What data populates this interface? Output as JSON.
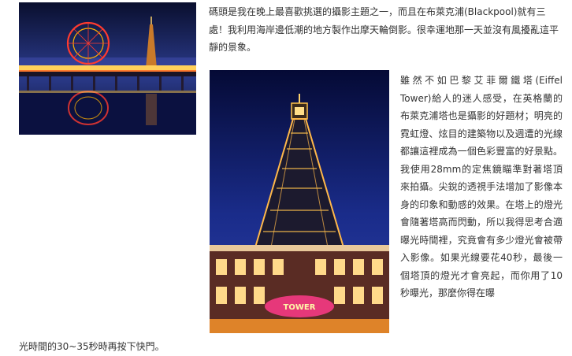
{
  "article": {
    "photo1_alt": "Blackpool pier ferris wheel at night reflected in water",
    "photo2_alt": "Blackpool Tower illuminated at night",
    "paragraph1": "碼頭是我在晚上最喜歡挑選的攝影主題之一，而且在布萊克浦(Blackpool)就有三處！我利用海岸邊低潮的地方製作出摩天輪倒影。很幸運地那一天並沒有風擾亂這平靜的景象。",
    "paragraph2": "雖然不如巴黎艾菲爾鐵塔(Eiffel Tower)給人的迷人感受，在英格蘭的布萊克浦塔也是攝影的好題材；明亮的霓虹燈、炫目的建築物以及週遭的光線都讓這裡成為一個色彩豐富的好景點。我使用28mm的定焦鏡瞄準對著塔頂來拍攝。尖銳的透視手法增加了影像本身的印象和動感的效果。在塔上的燈光會隨著塔高而閃動，所以我得思考合適曝光時間裡，究竟會有多少燈光會被帶入影像。如果光線要花40秒，最後一個塔頂的燈光才會亮起，而你用了10秒曝光，那麼你得在曝",
    "paragraph3": "光時間的30~35秒時再按下快門。",
    "sign_text": "TOWER"
  },
  "colors": {
    "text": "#333333",
    "night_sky_1": "#0a0f2e",
    "night_sky_2": "#2a3a9a",
    "neon_red": "#ff3b2f",
    "lights_gold": "#ffc24a"
  }
}
